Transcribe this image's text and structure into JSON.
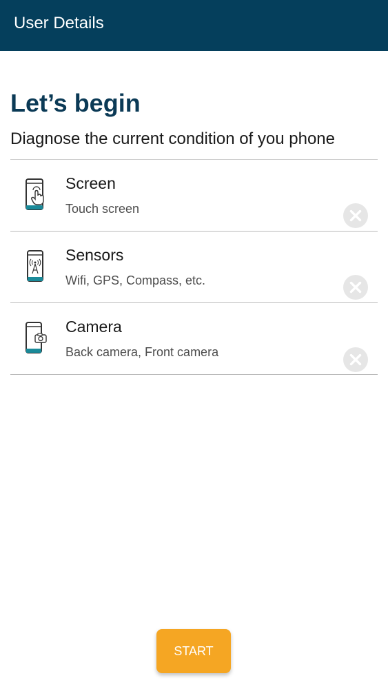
{
  "app_bar": {
    "title": "User Details",
    "background_color": "#053f5c"
  },
  "main": {
    "heading": "Let’s begin",
    "subheading": "Diagnose the current condition of you phone",
    "items": [
      {
        "title": "Screen",
        "subtitle": "Touch screen",
        "icon": "phone-touch-icon",
        "status_icon": "close-circle-icon"
      },
      {
        "title": "Sensors",
        "subtitle": "Wifi, GPS, Compass, etc.",
        "icon": "phone-sensor-icon",
        "status_icon": "close-circle-icon"
      },
      {
        "title": "Camera",
        "subtitle": "Back camera, Front camera",
        "icon": "phone-camera-icon",
        "status_icon": "close-circle-icon"
      }
    ]
  },
  "start_button": {
    "label": "START",
    "color": "#f5a623"
  },
  "colors": {
    "heading": "#0b3a56",
    "accent_teal": "#1a8a99",
    "status_gray": "#e6e6e6"
  }
}
